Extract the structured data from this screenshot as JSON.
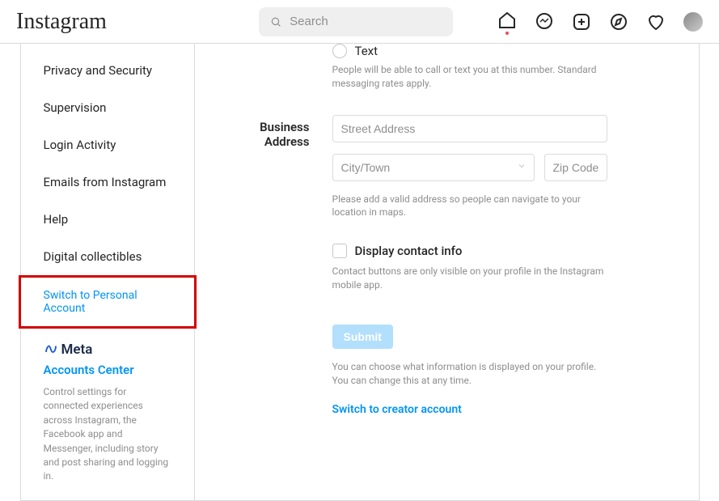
{
  "header": {
    "logo": "Instagram",
    "search_placeholder": "Search"
  },
  "sidebar": {
    "items": [
      "Privacy and Security",
      "Supervision",
      "Login Activity",
      "Emails from Instagram",
      "Help",
      "Digital collectibles"
    ],
    "switch_link": "Switch to Personal Account",
    "meta": {
      "brand": "Meta",
      "center": "Accounts Center",
      "desc": "Control settings for connected experiences across Instagram, the Facebook app and Messenger, including story and post sharing and logging in."
    }
  },
  "form": {
    "text_option": "Text",
    "text_hint": "People will be able to call or text you at this number. Standard messaging rates apply.",
    "address_label": "Business Address",
    "street_ph": "Street Address",
    "city_ph": "City/Town",
    "zip_ph": "Zip Code",
    "address_hint": "Please add a valid address so people can navigate to your location in maps.",
    "display_contact": "Display contact info",
    "display_hint": "Contact buttons are only visible on your profile in the Instagram mobile app.",
    "submit": "Submit",
    "submit_hint": "You can choose what information is displayed on your profile. You can change this at any time.",
    "switch_creator": "Switch to creator account"
  }
}
